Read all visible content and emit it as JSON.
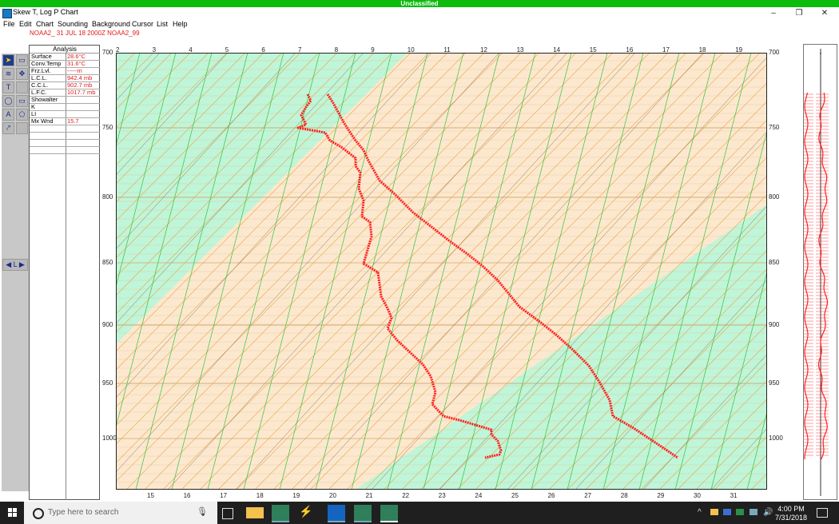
{
  "banner": "Unclassified",
  "window": {
    "title": "Skew T, Log P Chart",
    "minimize": "–",
    "restore": "❐",
    "close": "✕"
  },
  "menu": [
    "File",
    "Edit",
    "Chart",
    "Sounding",
    "Background",
    "Cursor",
    "List",
    "Help"
  ],
  "subtitle": "NOAA2_   31 JUL 18 2000Z   NOAA2_99",
  "toolbar": {
    "scroll_label": "◀ L ▶"
  },
  "analysis": {
    "title": "Analysis",
    "rows": [
      {
        "label": "Surface",
        "value": "28.6°C"
      },
      {
        "label": "Conv.Temp",
        "value": "31.6°C"
      },
      {
        "label": "Frz.Lvl.",
        "value": "-----m"
      },
      {
        "label": "L.C.L.",
        "value": "942.4 mb"
      },
      {
        "label": "C.C.L.",
        "value": "902.7 mb"
      },
      {
        "label": "L.F.C.",
        "value": "1017.7 mb"
      },
      {
        "label": "Showalter",
        "value": ""
      },
      {
        "label": "K",
        "value": ""
      },
      {
        "label": "LI",
        "value": ""
      },
      {
        "label": "Mx Wnd",
        "value": "15.7"
      }
    ]
  },
  "chart": {
    "top_ticks": [
      "2",
      "3",
      "4",
      "5",
      "6",
      "7",
      "8",
      "9",
      "10",
      "11",
      "12",
      "13",
      "14",
      "15",
      "16",
      "17",
      "18",
      "19"
    ],
    "bottom_ticks": [
      "15",
      "16",
      "17",
      "18",
      "19",
      "20",
      "21",
      "22",
      "23",
      "24",
      "25",
      "26",
      "27",
      "28",
      "29",
      "30",
      "31"
    ],
    "pressure_labels": [
      "700",
      "750",
      "800",
      "850",
      "900",
      "950",
      "1000"
    ]
  },
  "taskbar": {
    "search_placeholder": "Type here to search",
    "time": "4:00 PM",
    "date": "7/31/2018"
  }
}
